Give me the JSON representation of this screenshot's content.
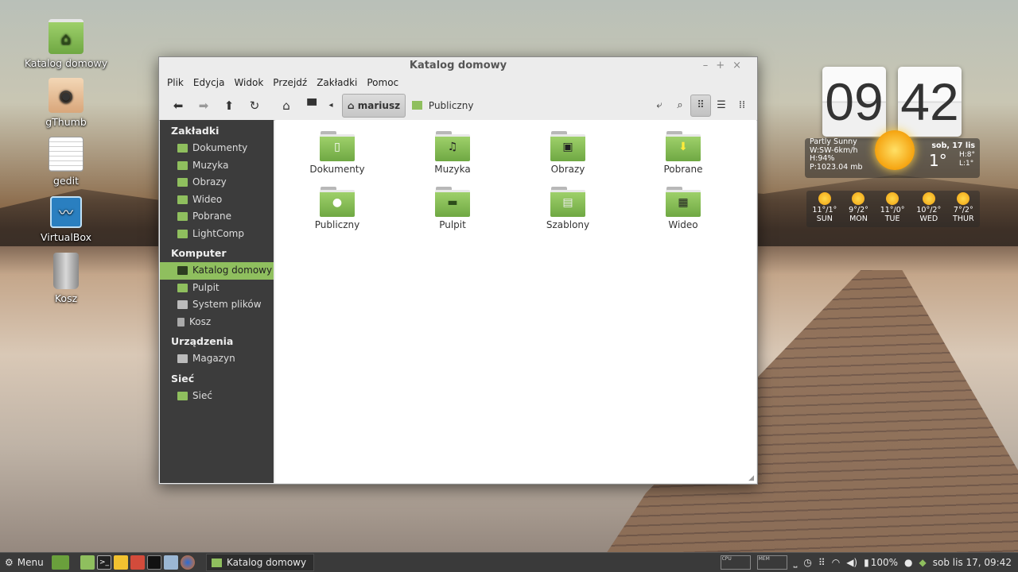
{
  "desktop": {
    "icons": [
      {
        "label": "Katalog domowy",
        "icon": "home-folder-icon"
      },
      {
        "label": "gThumb",
        "icon": "gthumb-eye-icon"
      },
      {
        "label": "gedit",
        "icon": "gedit-notepad-icon"
      },
      {
        "label": "VirtualBox",
        "icon": "virtualbox-icon"
      },
      {
        "label": "Kosz",
        "icon": "trash-icon"
      }
    ]
  },
  "window": {
    "title": "Katalog domowy",
    "controls": [
      "–",
      "+",
      "×"
    ],
    "menu": [
      "Plik",
      "Edycja",
      "Widok",
      "Przejdź",
      "Zakładki",
      "Pomoc"
    ],
    "breadcrumb": {
      "current": "mariusz",
      "next": "Publiczny"
    },
    "sidebar": {
      "sections": [
        {
          "title": "Zakładki",
          "items": [
            "Dokumenty",
            "Muzyka",
            "Obrazy",
            "Wideo",
            "Pobrane",
            "LightComp"
          ]
        },
        {
          "title": "Komputer",
          "items": [
            "Katalog domowy",
            "Pulpit",
            "System plików",
            "Kosz"
          ]
        },
        {
          "title": "Urządzenia",
          "items": [
            "Magazyn"
          ]
        },
        {
          "title": "Sieć",
          "items": [
            "Sieć"
          ]
        }
      ],
      "selected": "Katalog domowy"
    },
    "files": [
      {
        "name": "Dokumenty",
        "emblem": "document-icon",
        "glyph": "▯"
      },
      {
        "name": "Muzyka",
        "emblem": "music-icon",
        "glyph": "♫"
      },
      {
        "name": "Obrazy",
        "emblem": "picture-icon",
        "glyph": "▣"
      },
      {
        "name": "Pobrane",
        "emblem": "download-icon",
        "glyph": "⬇"
      },
      {
        "name": "Publiczny",
        "emblem": "person-icon",
        "glyph": "●"
      },
      {
        "name": "Pulpit",
        "emblem": "desktop-icon",
        "glyph": "▬"
      },
      {
        "name": "Szablony",
        "emblem": "template-icon",
        "glyph": "▤"
      },
      {
        "name": "Wideo",
        "emblem": "film-icon",
        "glyph": "▦"
      }
    ]
  },
  "clock": {
    "hours": "09",
    "minutes": "42",
    "condition": "Partly Sunny",
    "wind": "W:SW-6km/h",
    "humidity": "H:94%",
    "pressure": "P:1023.04 mb",
    "date": "sob, 17 lis",
    "temp": "1°",
    "high": "H:8°",
    "low": "L:1°",
    "forecast": [
      {
        "temps": "11°/1°",
        "day": "SUN"
      },
      {
        "temps": "9°/2°",
        "day": "MON"
      },
      {
        "temps": "11°/0°",
        "day": "TUE"
      },
      {
        "temps": "10°/2°",
        "day": "WED"
      },
      {
        "temps": "7°/2°",
        "day": "THUR"
      }
    ]
  },
  "panel": {
    "menu_label": "Menu",
    "task_label": "Katalog domowy",
    "battery": "100%",
    "datetime": "sob lis 17, 09:42",
    "monitor_labels": [
      "CPU",
      "MEM"
    ]
  },
  "colors": {
    "accent": "#8fbf5e",
    "sidebar_bg": "#3c3c3c",
    "panel_bg": "#3a3a3a"
  }
}
